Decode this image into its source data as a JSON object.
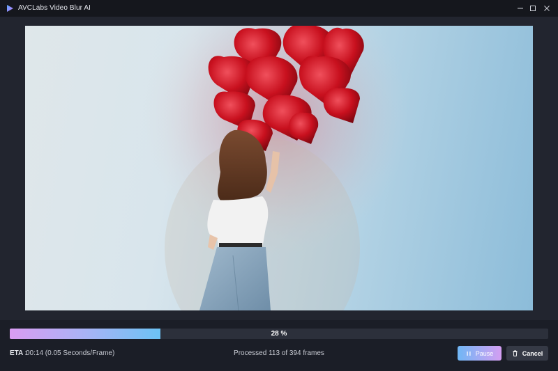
{
  "app": {
    "title": "AVCLabs Video Blur AI",
    "logo_icon": "avclabs-play-logo-icon"
  },
  "window_controls": [
    "minimize-icon",
    "maximize-icon",
    "close-icon"
  ],
  "preview": {
    "description_icon": "video-frame-preview"
  },
  "progress": {
    "percent": 28,
    "label": "28 %"
  },
  "status": {
    "eta_label": "ETA :",
    "eta_value": "00:14 (0.05 Seconds/Frame)",
    "processed_text": "Processed 113 of 394 frames"
  },
  "buttons": {
    "pause_label": "Pause",
    "cancel_label": "Cancel"
  },
  "colors": {
    "background": "#1b1e27",
    "accent_blue": "#70b7f5",
    "accent_pink": "#d49ef2"
  }
}
